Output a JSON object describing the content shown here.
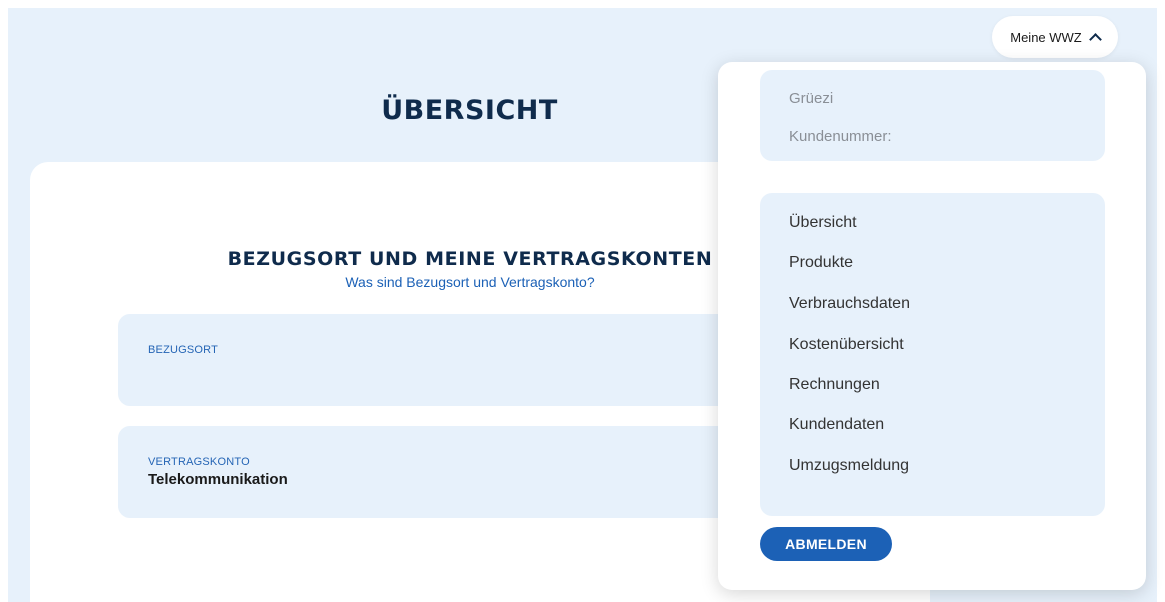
{
  "header": {
    "account_label": "Meine WWZ",
    "chevron_icon": "chevron-up-icon"
  },
  "main": {
    "page_title": "ÜBERSICHT",
    "section": {
      "title": "BEZUGSORT UND MEINE VERTRAGSKONTEN",
      "help_link": "Was sind Bezugsort und Vertragskonto?"
    },
    "boxes": [
      {
        "label": "BEZUGSORT",
        "value": ""
      },
      {
        "label": "VERTRAGSKONTO",
        "value": "Telekommunikation"
      }
    ]
  },
  "dropdown": {
    "greeting": "Grüezi",
    "customer_number_label": "Kundenummer:",
    "menu": [
      "Übersicht",
      "Produkte",
      "Verbrauchsdaten",
      "Kostenübersicht",
      "Rechnungen",
      "Kundendaten",
      "Umzugsmeldung"
    ],
    "logout_label": "ABMELDEN"
  },
  "colors": {
    "background": "#e7f1fb",
    "primary": "#1c61b6",
    "heading": "#0f2b4c"
  }
}
